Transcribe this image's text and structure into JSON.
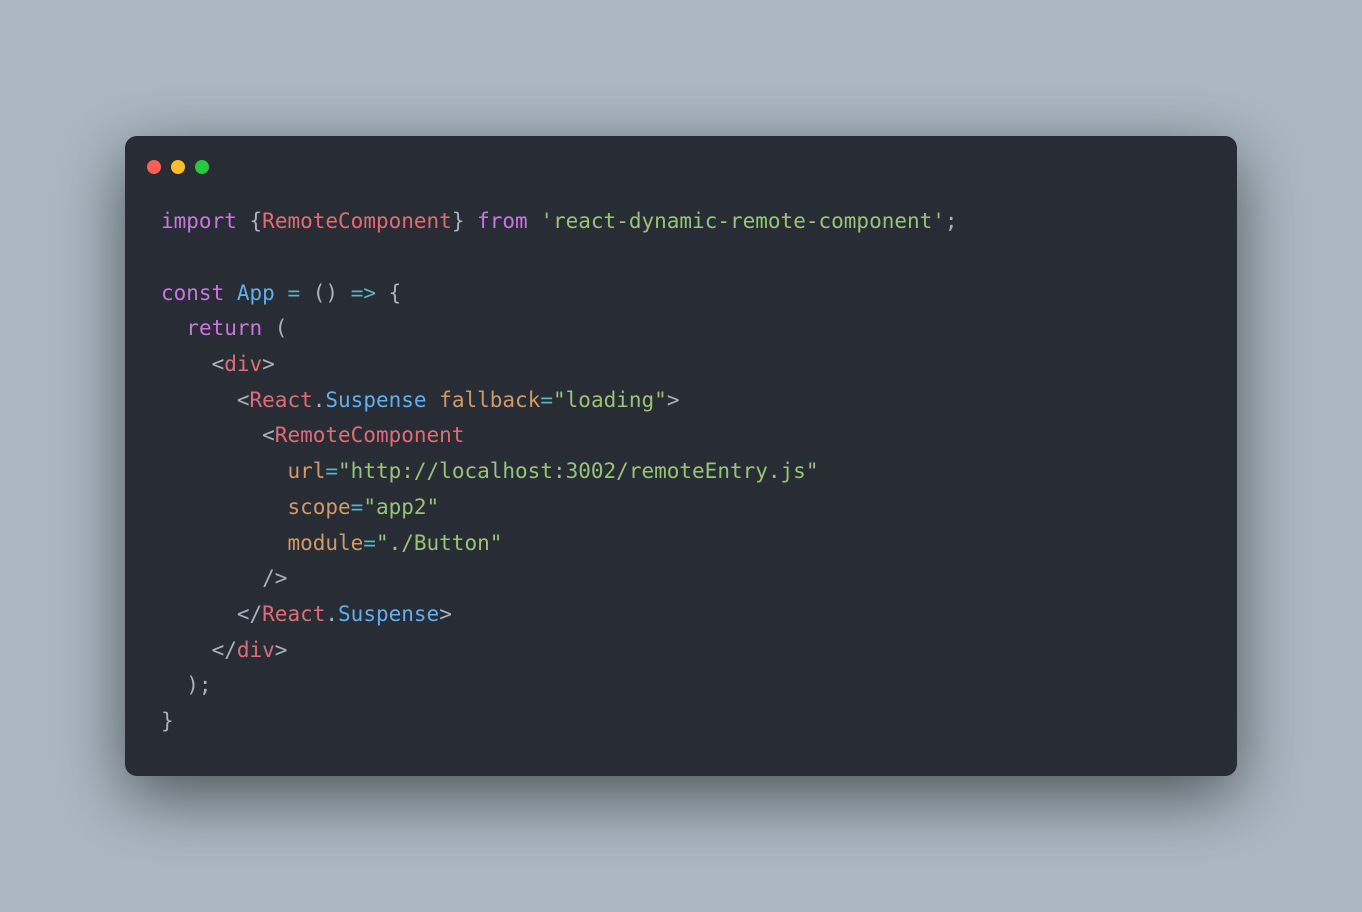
{
  "window": {
    "dots": [
      "red",
      "yellow",
      "green"
    ]
  },
  "code": {
    "tokens": [
      [
        {
          "t": "import ",
          "c": "tok-keyword"
        },
        {
          "t": "{",
          "c": "tok-punct"
        },
        {
          "t": "RemoteComponent",
          "c": "tok-name"
        },
        {
          "t": "}",
          "c": "tok-punct"
        },
        {
          "t": " from ",
          "c": "tok-keyword"
        },
        {
          "t": "'react-dynamic-remote-component'",
          "c": "tok-string"
        },
        {
          "t": ";",
          "c": "tok-punct"
        }
      ],
      [],
      [
        {
          "t": "const ",
          "c": "tok-keyword"
        },
        {
          "t": "App",
          "c": "tok-func"
        },
        {
          "t": " ",
          "c": "tok-punct"
        },
        {
          "t": "=",
          "c": "tok-op"
        },
        {
          "t": " ",
          "c": "tok-punct"
        },
        {
          "t": "(",
          "c": "tok-punct"
        },
        {
          "t": ")",
          "c": "tok-punct"
        },
        {
          "t": " ",
          "c": "tok-punct"
        },
        {
          "t": "=>",
          "c": "tok-op"
        },
        {
          "t": " {",
          "c": "tok-punct"
        }
      ],
      [
        {
          "t": "  ",
          "c": "tok-punct"
        },
        {
          "t": "return",
          "c": "tok-keyword"
        },
        {
          "t": " (",
          "c": "tok-punct"
        }
      ],
      [
        {
          "t": "    <",
          "c": "tok-punct"
        },
        {
          "t": "div",
          "c": "tok-tag"
        },
        {
          "t": ">",
          "c": "tok-punct"
        }
      ],
      [
        {
          "t": "      <",
          "c": "tok-punct"
        },
        {
          "t": "React",
          "c": "tok-name"
        },
        {
          "t": ".",
          "c": "tok-punct"
        },
        {
          "t": "Suspense",
          "c": "tok-func"
        },
        {
          "t": " ",
          "c": "tok-punct"
        },
        {
          "t": "fallback",
          "c": "tok-attr"
        },
        {
          "t": "=",
          "c": "tok-op"
        },
        {
          "t": "\"loading\"",
          "c": "tok-string"
        },
        {
          "t": ">",
          "c": "tok-punct"
        }
      ],
      [
        {
          "t": "        <",
          "c": "tok-punct"
        },
        {
          "t": "RemoteComponent",
          "c": "tok-name"
        }
      ],
      [
        {
          "t": "          ",
          "c": "tok-punct"
        },
        {
          "t": "url",
          "c": "tok-attr"
        },
        {
          "t": "=",
          "c": "tok-op"
        },
        {
          "t": "\"http://localhost:3002/remoteEntry.js\"",
          "c": "tok-string"
        }
      ],
      [
        {
          "t": "          ",
          "c": "tok-punct"
        },
        {
          "t": "scope",
          "c": "tok-attr"
        },
        {
          "t": "=",
          "c": "tok-op"
        },
        {
          "t": "\"app2\"",
          "c": "tok-string"
        }
      ],
      [
        {
          "t": "          ",
          "c": "tok-punct"
        },
        {
          "t": "module",
          "c": "tok-attr"
        },
        {
          "t": "=",
          "c": "tok-op"
        },
        {
          "t": "\"./Button\"",
          "c": "tok-string"
        }
      ],
      [
        {
          "t": "        />",
          "c": "tok-punct"
        }
      ],
      [
        {
          "t": "      </",
          "c": "tok-punct"
        },
        {
          "t": "React",
          "c": "tok-name"
        },
        {
          "t": ".",
          "c": "tok-punct"
        },
        {
          "t": "Suspense",
          "c": "tok-func"
        },
        {
          "t": ">",
          "c": "tok-punct"
        }
      ],
      [
        {
          "t": "    </",
          "c": "tok-punct"
        },
        {
          "t": "div",
          "c": "tok-tag"
        },
        {
          "t": ">",
          "c": "tok-punct"
        }
      ],
      [
        {
          "t": "  );",
          "c": "tok-punct"
        }
      ],
      [
        {
          "t": "}",
          "c": "tok-punct"
        }
      ]
    ]
  }
}
